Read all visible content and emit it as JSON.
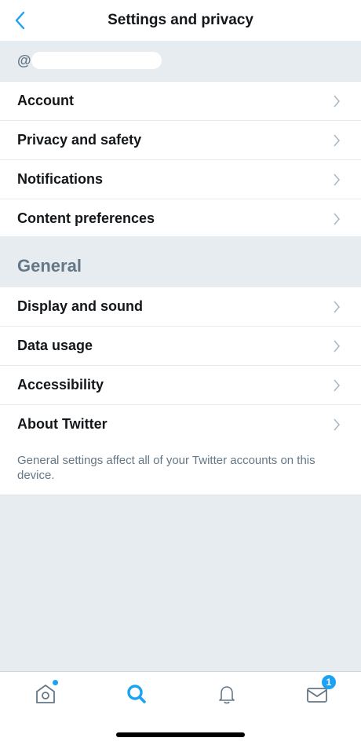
{
  "header": {
    "title": "Settings and privacy",
    "back_icon": "chevron-left-icon"
  },
  "account": {
    "handle_prefix": "@"
  },
  "account_items": [
    {
      "label": "Account"
    },
    {
      "label": "Privacy and safety"
    },
    {
      "label": "Notifications"
    },
    {
      "label": "Content preferences"
    }
  ],
  "general": {
    "header": "General",
    "items": [
      {
        "label": "Display and sound"
      },
      {
        "label": "Data usage"
      },
      {
        "label": "Accessibility"
      },
      {
        "label": "About Twitter"
      }
    ],
    "footnote": "General settings affect all of your Twitter accounts on this device."
  },
  "tabbar": {
    "tabs": [
      {
        "icon": "home-icon"
      },
      {
        "icon": "search-icon"
      },
      {
        "icon": "bell-icon"
      },
      {
        "icon": "mail-icon"
      }
    ],
    "messages_badge": "1"
  },
  "colors": {
    "accent": "#1da1f2",
    "background": "#e6ecf0",
    "secondary_text": "#657786",
    "primary_text": "#14171a"
  }
}
